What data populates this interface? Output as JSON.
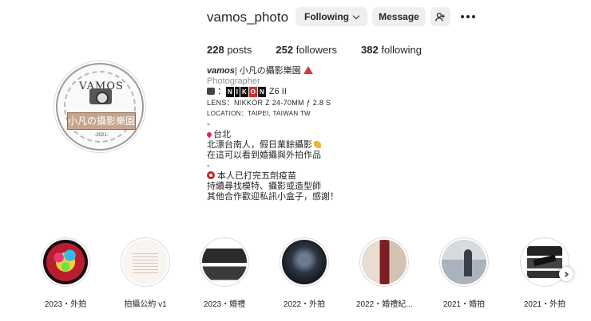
{
  "profile": {
    "username": "vamos_photo",
    "avatar_text": {
      "brand": "VAMOS",
      "banner": "小凡の攝影樂園",
      "year": "-2021-"
    }
  },
  "actions": {
    "following_label": "Following",
    "message_label": "Message",
    "add_user_icon": "person-add-icon",
    "more_icon": "more-options-icon"
  },
  "stats": {
    "posts_count": "228",
    "posts_label": "posts",
    "followers_count": "252",
    "followers_label": "followers",
    "following_count": "382",
    "following_label": "following"
  },
  "bio": {
    "name_bold": "vamos",
    "name_rest": "| 小凡の攝影樂園",
    "category": "Photographer",
    "camera_prefix": "：",
    "camera_brand": [
      "N",
      "I",
      "K",
      "O",
      "N"
    ],
    "camera_model": "Z6 II",
    "lens_line": "LENS：NIKKOR Z 24-70MM ƒ 2.8 S",
    "location_line": "LOCATION：TAIPEI, TAIWAN TW",
    "separator1": "-",
    "city": "台北",
    "line_intro1": "北漂台南人，假日業餘攝影",
    "line_intro2": "在這可以看到婚攝與外拍作品",
    "separator2": "-",
    "line_vaccine": "本人已打完五劑疫苗",
    "line_seek": "持續尋找模特、攝影或造型師",
    "line_contact": "其他合作歡迎私訊小盒子，感謝！"
  },
  "highlights": [
    {
      "label": "2023・外拍",
      "icon": "disco-ball-thumbnail"
    },
    {
      "label": "拍攝公約 v1",
      "icon": "document-thumbnail"
    },
    {
      "label": "2023・婚禮",
      "icon": "wedding-collage-thumbnail"
    },
    {
      "label": "2022・外拍",
      "icon": "couple-portrait-thumbnail"
    },
    {
      "label": "2022・婚禮紀...",
      "icon": "bride-red-dress-thumbnail"
    },
    {
      "label": "2021・婚拍",
      "icon": "prewedding-thumbnail"
    },
    {
      "label": "2021・外拍",
      "icon": "new-year-collage-thumbnail"
    }
  ],
  "colors": {
    "button_bg": "#efefef",
    "text": "#262626",
    "secondary_text": "#8e8e8e",
    "border": "#dbdbdb"
  }
}
